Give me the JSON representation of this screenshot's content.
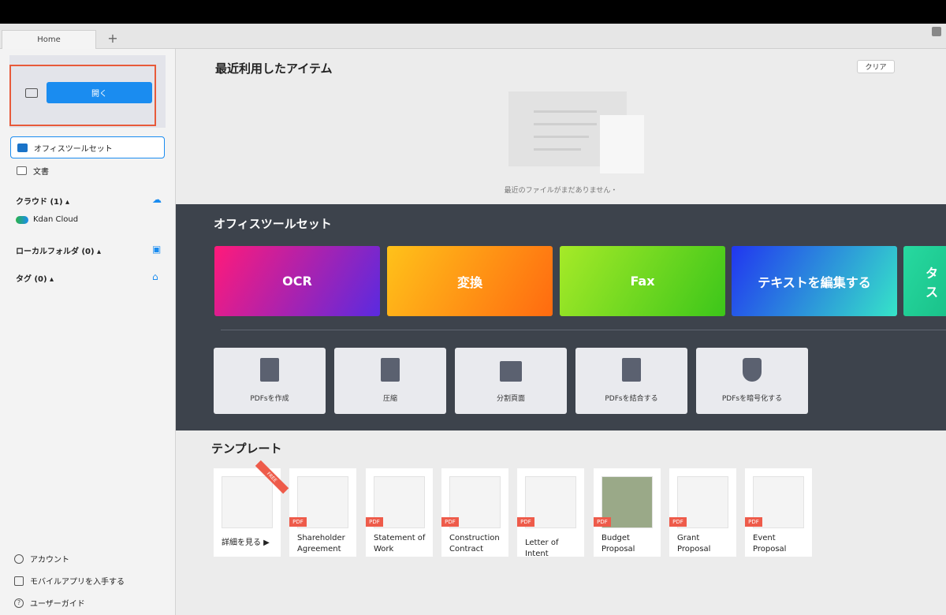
{
  "tabs": {
    "home": "Home",
    "add": "+"
  },
  "sidebar": {
    "open_label": "開く",
    "items": [
      {
        "label": "オフィスツールセット"
      },
      {
        "label": "文書"
      }
    ],
    "cloud_heading": "クラウド (1) ▴",
    "cloud_item": "Kdan Cloud",
    "local_heading": "ローカルフォルダ (0) ▴",
    "tag_heading": "タグ (0) ▴",
    "bottom": [
      {
        "label": "アカウント"
      },
      {
        "label": "モバイルアプリを入手する"
      },
      {
        "label": "ユーザーガイド"
      }
    ]
  },
  "recent": {
    "title": "最近利用したアイテム",
    "clear_label": "クリア",
    "empty_text": "最近のファイルがまだありません・"
  },
  "toolset": {
    "title": "オフィスツールセット",
    "features": [
      {
        "label": "OCR",
        "colors": [
          "#ff1a7a",
          "#5a2ae0"
        ]
      },
      {
        "label": "変換",
        "colors": [
          "#ffc21a",
          "#ff6a10"
        ]
      },
      {
        "label": "Fax",
        "colors": [
          "#a6ea28",
          "#3cc61a"
        ]
      },
      {
        "label": "テキストを編集する",
        "colors": [
          "#2136f0",
          "#36e4c8"
        ]
      },
      {
        "label": "タス",
        "colors": [
          "#27d9a0",
          "#1ac28a"
        ]
      }
    ],
    "actions": [
      {
        "label": "PDFsを作成"
      },
      {
        "label": "圧縮"
      },
      {
        "label": "分割頁面"
      },
      {
        "label": "PDFsを結合する"
      },
      {
        "label": "PDFsを暗号化する"
      }
    ]
  },
  "templates": {
    "title": "テンプレート",
    "pdf_badge": "PDF",
    "free_badge": "FREE",
    "items": [
      {
        "name": "詳細を見る ▶"
      },
      {
        "name": "Shareholder Agreement"
      },
      {
        "name": "Statement of Work"
      },
      {
        "name": "Construction Contract"
      },
      {
        "name": "Letter of Intent"
      },
      {
        "name": "Budget Proposal"
      },
      {
        "name": "Grant Proposal"
      },
      {
        "name": "Event Proposal"
      }
    ]
  }
}
